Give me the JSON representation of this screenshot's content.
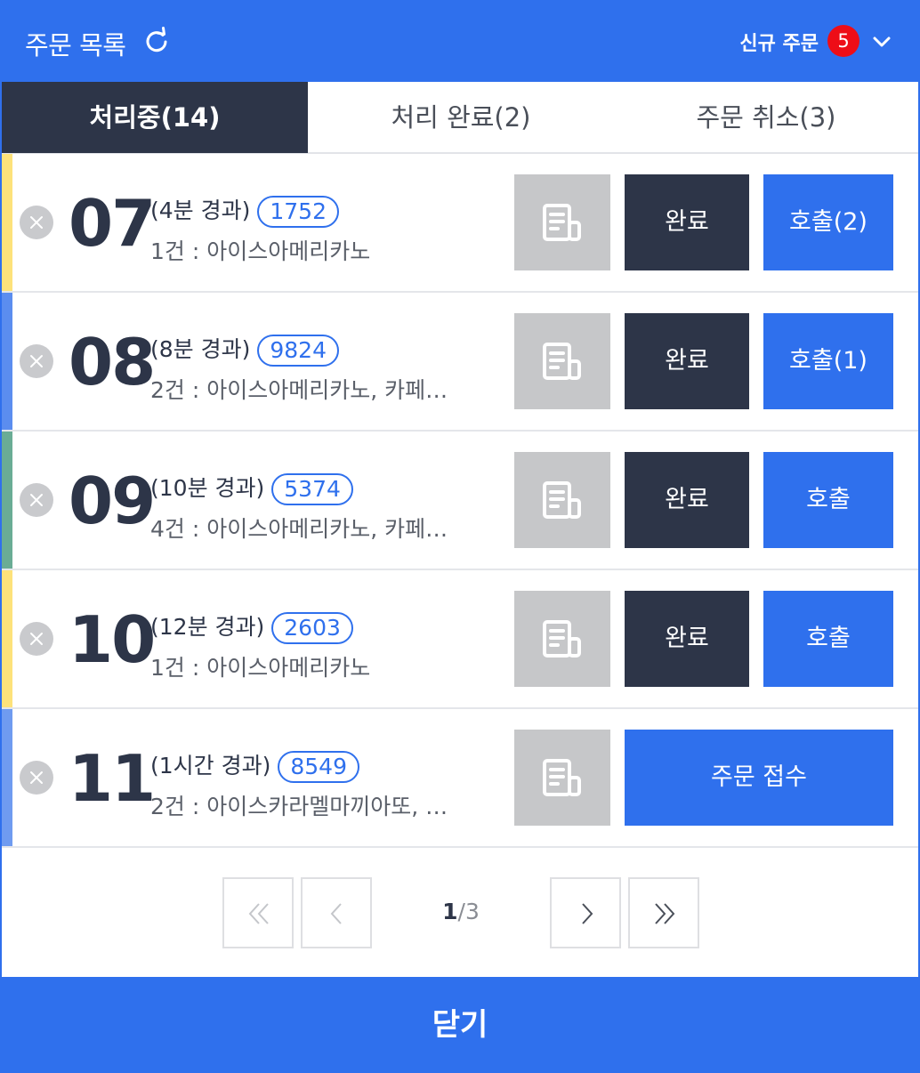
{
  "header": {
    "title": "주문 목록",
    "new_order_label": "신규 주문",
    "new_order_count": "5",
    "icons": [
      "refresh-icon",
      "chevron-down-icon"
    ]
  },
  "tabs": [
    {
      "label": "처리중(14)",
      "active": true
    },
    {
      "label": "처리 완료(2)",
      "active": false
    },
    {
      "label": "주문 취소(3)",
      "active": false
    }
  ],
  "orders": [
    {
      "number": "07",
      "elapsed": "(4분 경과)",
      "code": "1752",
      "items": "1건 : 아이스아메리카노",
      "stripe_color": "#fde27a",
      "done_label": "완료",
      "call_label": "호출(2)"
    },
    {
      "number": "08",
      "elapsed": "(8분 경과)",
      "code": "9824",
      "items": "2건 : 아이스아메리카노, 카페…",
      "stripe_color": "#5b8def",
      "done_label": "완료",
      "call_label": "호출(1)"
    },
    {
      "number": "09",
      "elapsed": "(10분 경과)",
      "code": "5374",
      "items": "4건 : 아이스아메리카노, 카페…",
      "stripe_color": "#6aac95",
      "done_label": "완료",
      "call_label": "호출"
    },
    {
      "number": "10",
      "elapsed": "(12분 경과)",
      "code": "2603",
      "items": "1건 : 아이스아메리카노",
      "stripe_color": "#fde27a",
      "done_label": "완료",
      "call_label": "호출"
    },
    {
      "number": "11",
      "elapsed": "(1시간 경과)",
      "code": "8549",
      "items": "2건 : 아이스카라멜마끼아또, …",
      "stripe_color": "#6f9bf0",
      "accept_label": "주문 접수"
    }
  ],
  "pagination": {
    "current": "1",
    "total": "/3"
  },
  "footer": {
    "close_label": "닫기"
  },
  "colors": {
    "accent": "#2f70ed",
    "dark": "#2d3548",
    "badge": "#ee0d17",
    "disabled": "#c6c7c9"
  }
}
